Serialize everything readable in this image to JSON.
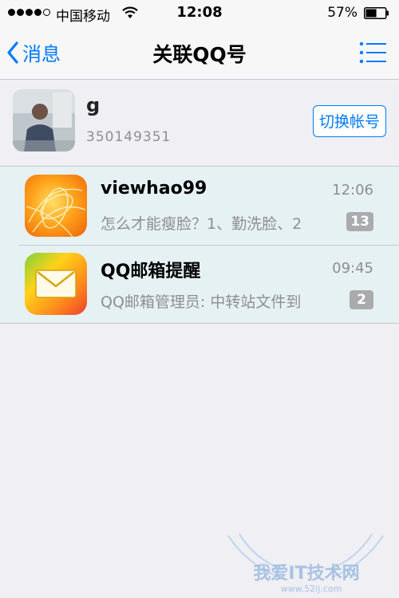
{
  "status_bar": {
    "carrier": "中国移动",
    "time": "12:08",
    "battery": "57%",
    "battery_level": 0.57,
    "signal_bars": 4,
    "signal_max": 5
  },
  "nav": {
    "back_label": "消息",
    "title": "关联QQ号",
    "accent_color": "#007aff"
  },
  "account": {
    "name": "g",
    "number": "350149351",
    "switch_label": "切换帐号"
  },
  "messages": [
    {
      "title": "viewhao99",
      "time": "12:06",
      "preview": "怎么才能瘦脸？1、勤洗脸、2",
      "badge": "13",
      "icon": "orange-swirl-avatar"
    },
    {
      "title": "QQ邮箱提醒",
      "time": "09:45",
      "preview": "QQ邮箱管理员: 中转站文件到",
      "badge": "2",
      "icon": "qq-mail-envelope-icon"
    }
  ],
  "watermark": {
    "line1": "我爱IT技术网",
    "line2": "www.52ij.com"
  }
}
